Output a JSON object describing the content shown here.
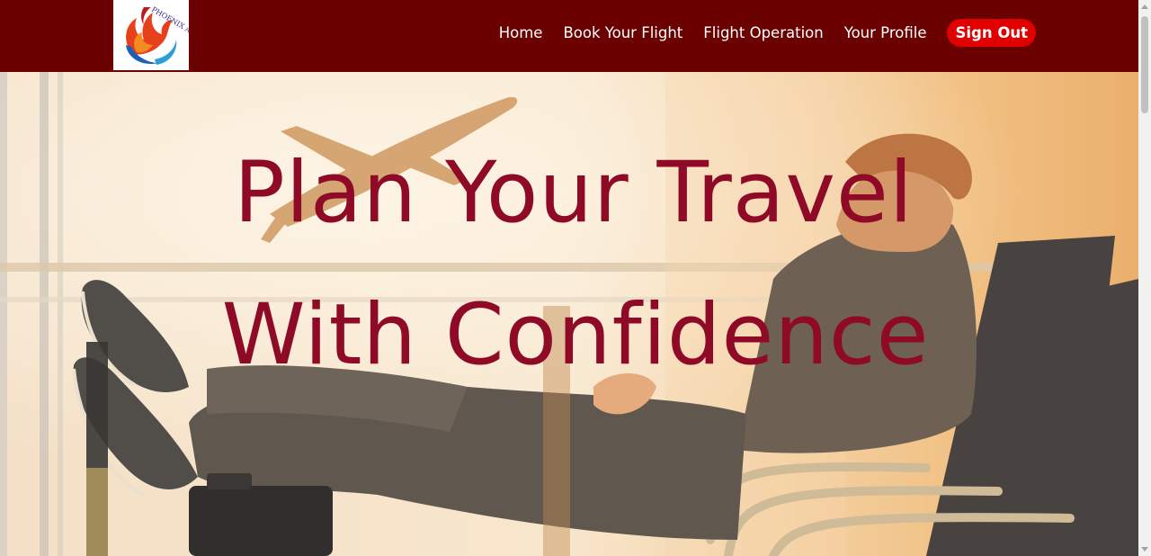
{
  "brand": {
    "logo_text": "PHOENIX AIR",
    "logo_icon": "phoenix-bird-icon"
  },
  "nav": {
    "items": [
      {
        "label": "Home"
      },
      {
        "label": "Book Your Flight"
      },
      {
        "label": "Flight Operation"
      },
      {
        "label": "Your Profile"
      }
    ],
    "signout_label": "Sign Out"
  },
  "hero": {
    "line1": "Plan Your Travel",
    "line2": "With Confidence"
  },
  "colors": {
    "navbar": "#6a0000",
    "signout": "#e00000",
    "headline": "#8e0a26"
  }
}
